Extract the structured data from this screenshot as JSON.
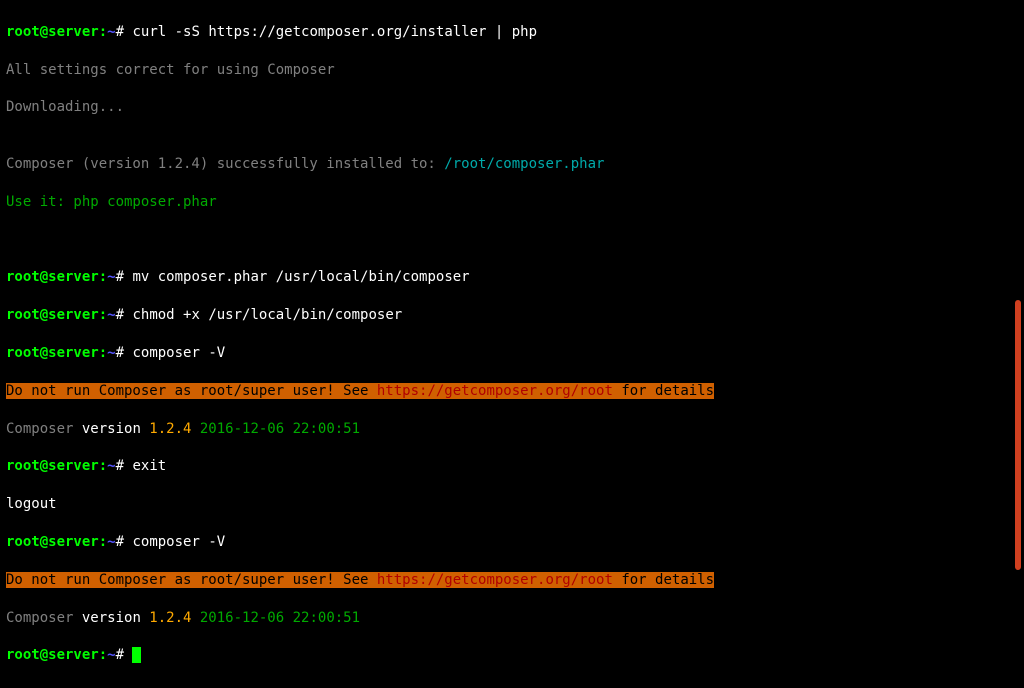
{
  "prompts": {
    "user": "root@server",
    "sep": ":",
    "path": "~",
    "hash": "#"
  },
  "lines": {
    "cmd1": " curl -sS https://getcomposer.org/installer | php",
    "out1": "All settings correct for using Composer",
    "out2": "Downloading...",
    "blank": "",
    "out3a": "Composer (version 1.2.4) successfully installed to: ",
    "out3b": "/root/composer.phar",
    "out4": "Use it: php composer.phar",
    "cmd2": " mv composer.phar /usr/local/bin/composer",
    "cmd3": " chmod +x /usr/local/bin/composer",
    "cmd4": " composer -V",
    "warn1a": "Do not run Composer as root/super user! See ",
    "warn1b": "https://getcomposer.org/root",
    "warn1c": " for details",
    "ver1a": "Composer",
    "ver1b": " version ",
    "ver1c": "1.2.4",
    "ver1d": " 2016-12-06 22:00:51",
    "cmd5": " exit",
    "out5": "logout",
    "cmd6": " composer -V",
    "cmd7": " "
  }
}
